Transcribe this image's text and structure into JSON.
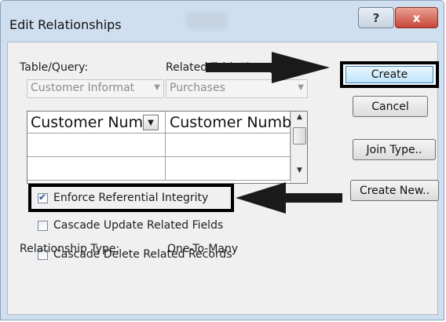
{
  "window": {
    "title": "Edit Relationships",
    "help_glyph": "?",
    "close_glyph": "x"
  },
  "table_query": {
    "label": "Table/Query:",
    "value": "Customer Informat"
  },
  "related_table_query": {
    "label": "Related Table/Query:",
    "value": "Purchases"
  },
  "grid": {
    "left_header": "Customer Num",
    "right_header": "Customer Numbe",
    "rows": [
      [
        "",
        ""
      ],
      [
        "",
        ""
      ]
    ]
  },
  "options": {
    "enforce_integrity": {
      "label": "Enforce Referential Integrity",
      "checked": true
    },
    "cascade_update": {
      "label": "Cascade Update Related Fields",
      "checked": false
    },
    "cascade_delete": {
      "label": "Cascade Delete Related Records",
      "checked": false
    }
  },
  "relationship_type": {
    "label": "Relationship Type:",
    "value": "One-To-Many"
  },
  "buttons": {
    "create": "Create",
    "cancel": "Cancel",
    "join_type": "Join Type..",
    "create_new": "Create New.."
  },
  "annotation_color": "#000000",
  "icons": {
    "combo_arrow": "chevron-down-icon",
    "help": "help-icon",
    "close": "close-icon"
  }
}
